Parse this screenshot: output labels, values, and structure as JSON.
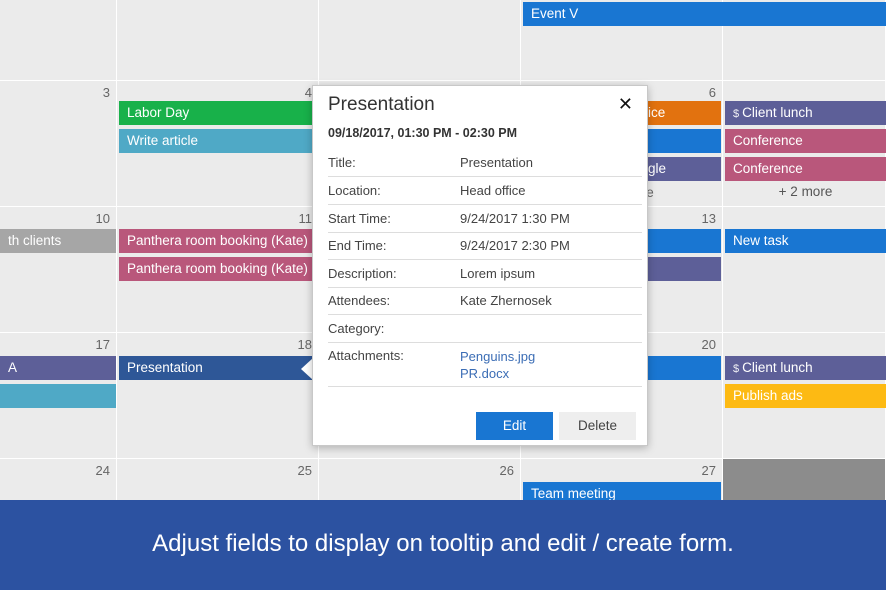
{
  "calendar": {
    "day_numbers": {
      "r1c0": "3",
      "r1c1": "4",
      "r1c3": "6",
      "r2c0": "10",
      "r2c1": "11",
      "r2c3": "13",
      "r3c0": "17",
      "r3c1": "18",
      "r3c3": "20",
      "r4c0": "24",
      "r4c1": "25",
      "r4c2": "26",
      "r4c3": "27"
    },
    "events": {
      "event_v": "Event V",
      "labor_day": "Labor Day",
      "write_article": "Write article",
      "partial_ice": "ice",
      "partial_gle": "gle",
      "partial_e": "e",
      "client_lunch_1": "Client lunch",
      "conference_1": "Conference",
      "conference_2": "Conference",
      "more": "+ 2 more",
      "partial_clients": "th clients",
      "panthera_1": "Panthera room booking (Kate)",
      "panthera_2": "Panthera room booking (Kate)",
      "new_task": "New task",
      "partial_a": "A",
      "presentation": "Presentation",
      "client_lunch_2": "Client lunch",
      "publish_ads": "Publish ads",
      "team_meeting": "Team meeting"
    },
    "colors": {
      "blue": "#1976d2",
      "green": "#18b14a",
      "teal": "#4fa9c6",
      "orange": "#e2720f",
      "purple": "#5d5f98",
      "pink": "#b9577b",
      "gray": "#a6a6a6",
      "navy": "#2e5797",
      "yellow": "#fdba13"
    }
  },
  "tooltip": {
    "title": "Presentation",
    "close_glyph": "✕",
    "date_range": "09/18/2017, 01:30 PM - 02:30 PM",
    "fields": [
      {
        "label": "Title:",
        "value": "Presentation"
      },
      {
        "label": "Location:",
        "value": "Head office"
      },
      {
        "label": "Start Time:",
        "value": "9/24/2017 1:30 PM"
      },
      {
        "label": "End Time:",
        "value": "9/24/2017 2:30 PM"
      },
      {
        "label": "Description:",
        "value": "Lorem ipsum"
      },
      {
        "label": "Attendees:",
        "value": "Kate Zhernosek"
      },
      {
        "label": "Category:",
        "value": ""
      },
      {
        "label": "Attachments:",
        "value": ""
      }
    ],
    "attachments": [
      "Penguins.jpg",
      "PR.docx"
    ],
    "edit_label": "Edit",
    "delete_label": "Delete"
  },
  "banner": {
    "text": "Adjust fields to display on tooltip and edit / create form."
  }
}
